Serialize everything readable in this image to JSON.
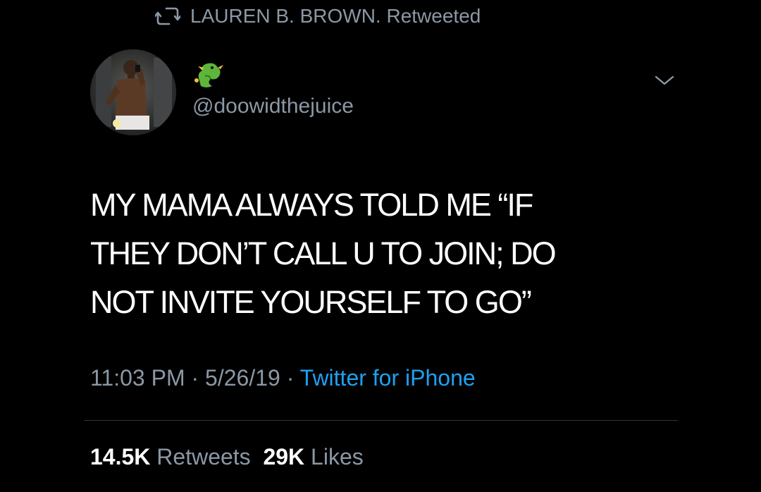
{
  "retweet_header": {
    "icon": "retweet-icon",
    "text": "LAUREN B. BROWN. Retweeted"
  },
  "author": {
    "avatar_icon": "profile-photo",
    "name_emoji_icon": "dragon-emoji-icon",
    "handle": "@doowidthejuice"
  },
  "menu": {
    "icon": "chevron-down-icon"
  },
  "tweet": {
    "lines": [
      "MY MAMA ALWAYS TOLD ME “IF",
      "THEY DON’T CALL U TO JOIN; DO",
      "NOT INVITE YOURSELF TO GO”"
    ]
  },
  "meta": {
    "time": "11:03 PM",
    "sep1": " · ",
    "date": "5/26/19",
    "sep2": " · ",
    "source": "Twitter for iPhone"
  },
  "stats": {
    "retweets_count": "14.5K",
    "retweets_label": "Retweets",
    "likes_count": "29K",
    "likes_label": "Likes"
  },
  "colors": {
    "background": "#000000",
    "secondary_text": "#8b98a5",
    "link": "#1da1f2",
    "divider": "#2f3336"
  }
}
